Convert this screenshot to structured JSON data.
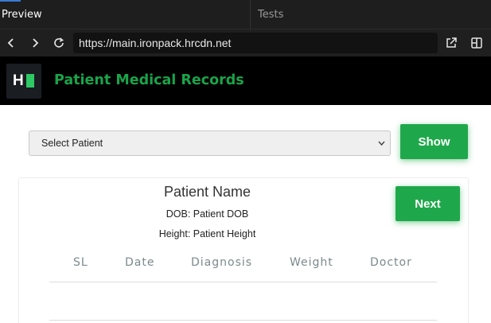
{
  "ide": {
    "tabs": [
      {
        "label": "Preview"
      },
      {
        "label": "Tests"
      }
    ]
  },
  "browser": {
    "url": "https://main.ironpack.hrcdn.net",
    "icons": [
      "back-arrow-icon",
      "forward-arrow-icon",
      "reload-icon",
      "open-external-icon",
      "split-view-icon"
    ]
  },
  "header": {
    "logo_text": "H",
    "title": "Patient Medical Records"
  },
  "controls": {
    "select_value": "Select Patient",
    "show_label": "Show"
  },
  "patient": {
    "name": "Patient Name",
    "dob": "DOB: Patient DOB",
    "height": "Height: Patient Height",
    "next_label": "Next"
  },
  "table": {
    "columns": [
      "SL",
      "Date",
      "Diagnosis",
      "Weight",
      "Doctor"
    ]
  },
  "colors": {
    "accent": "#1fa84b",
    "header_bg": "#000000",
    "title": "#1aa34a"
  }
}
